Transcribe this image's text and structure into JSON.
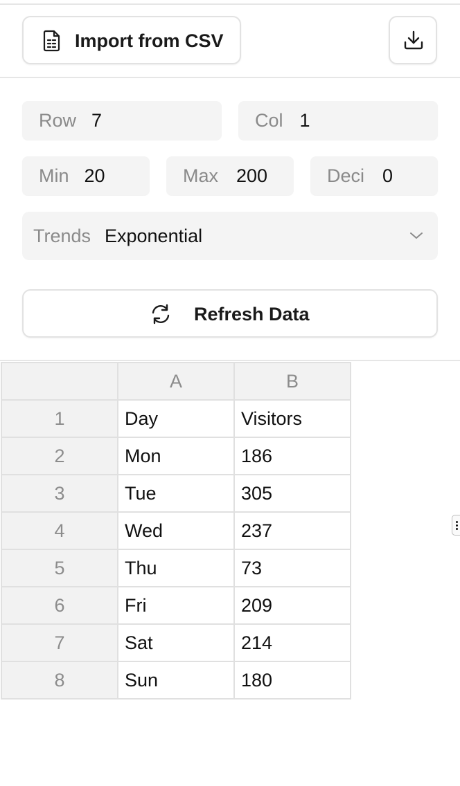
{
  "toolbar": {
    "import_label": "Import from CSV",
    "import_icon": "file-spreadsheet-icon",
    "download_icon": "download-icon"
  },
  "settings": {
    "row": {
      "label": "Row",
      "value": "7"
    },
    "col": {
      "label": "Col",
      "value": "1"
    },
    "min": {
      "label": "Min",
      "value": "20"
    },
    "max": {
      "label": "Max",
      "value": "200"
    },
    "deci": {
      "label": "Deci",
      "value": "0"
    },
    "trends": {
      "label": "Trends",
      "value": "Exponential",
      "icon": "chevron-down-icon"
    }
  },
  "refresh": {
    "label": "Refresh Data",
    "icon": "refresh-icon"
  },
  "sheet": {
    "columns": [
      "A",
      "B"
    ],
    "rows": [
      {
        "num": "1",
        "a": "Day",
        "b": "Visitors"
      },
      {
        "num": "2",
        "a": "Mon",
        "b": "186"
      },
      {
        "num": "3",
        "a": "Tue",
        "b": "305"
      },
      {
        "num": "4",
        "a": "Wed",
        "b": "237"
      },
      {
        "num": "5",
        "a": "Thu",
        "b": "73"
      },
      {
        "num": "6",
        "a": "Fri",
        "b": "209"
      },
      {
        "num": "7",
        "a": "Sat",
        "b": "214"
      },
      {
        "num": "8",
        "a": "Sun",
        "b": "180"
      }
    ]
  },
  "colors": {
    "field_bg": "#f4f4f4",
    "border": "#e2e2e2",
    "muted_text": "#8a8a8a"
  }
}
